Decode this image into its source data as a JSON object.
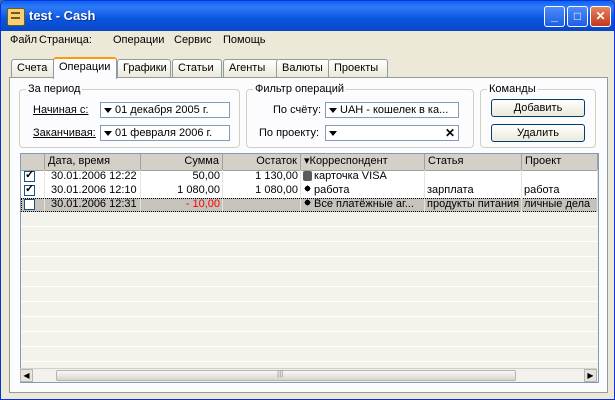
{
  "window": {
    "title": "test - Cash"
  },
  "menu": [
    "Файл",
    "Страница:",
    "Операции",
    "Сервис",
    "Помощь"
  ],
  "tabs": [
    "Счета",
    "Операции",
    "Графики",
    "Статьи",
    "Агенты",
    "Валюты",
    "Проекты"
  ],
  "active_tab": "Операции",
  "period": {
    "title": "За период",
    "start_label": "Начиная с:",
    "start_value": "01 декабря 2005 г.",
    "end_label": "Заканчивая:",
    "end_value": "01 февраля 2006 г."
  },
  "filter": {
    "title": "Фильтр операций",
    "account_label": "По счёту:",
    "account_value": "UAH - кошелек в ка...",
    "project_label": "По проекту:",
    "project_value": ""
  },
  "commands": {
    "title": "Команды",
    "add_label": "Добавить",
    "delete_label": "Удалить"
  },
  "table": {
    "columns": [
      "Дата, время",
      "Сумма",
      "Остаток",
      "Корреспондент",
      "Статья",
      "Проект"
    ],
    "rows": [
      {
        "checked": true,
        "date": "30.01.2006 12:22",
        "amount": "50,00",
        "balance": "1 130,00",
        "correspondent": "карточка VISA",
        "icon": "card-icon",
        "article": "",
        "project": ""
      },
      {
        "checked": true,
        "date": "30.01.2006 12:10",
        "amount": "1 080,00",
        "balance": "1 080,00",
        "correspondent": "работа",
        "icon": "person-icon",
        "article": "зарплата",
        "project": "работа"
      },
      {
        "checked": false,
        "date": "30.01.2006 12:31",
        "amount": "- 10,00",
        "balance": "",
        "correspondent": "Все платёжные аг...",
        "icon": "person-icon",
        "article": "продукты питания",
        "project": "личные дела",
        "selected": true,
        "amount_color": "#ff0000"
      }
    ]
  },
  "colors": {
    "selected_row": "#c5c3bb",
    "negative": "#ff0000",
    "title_bar": "#0a55e0"
  }
}
